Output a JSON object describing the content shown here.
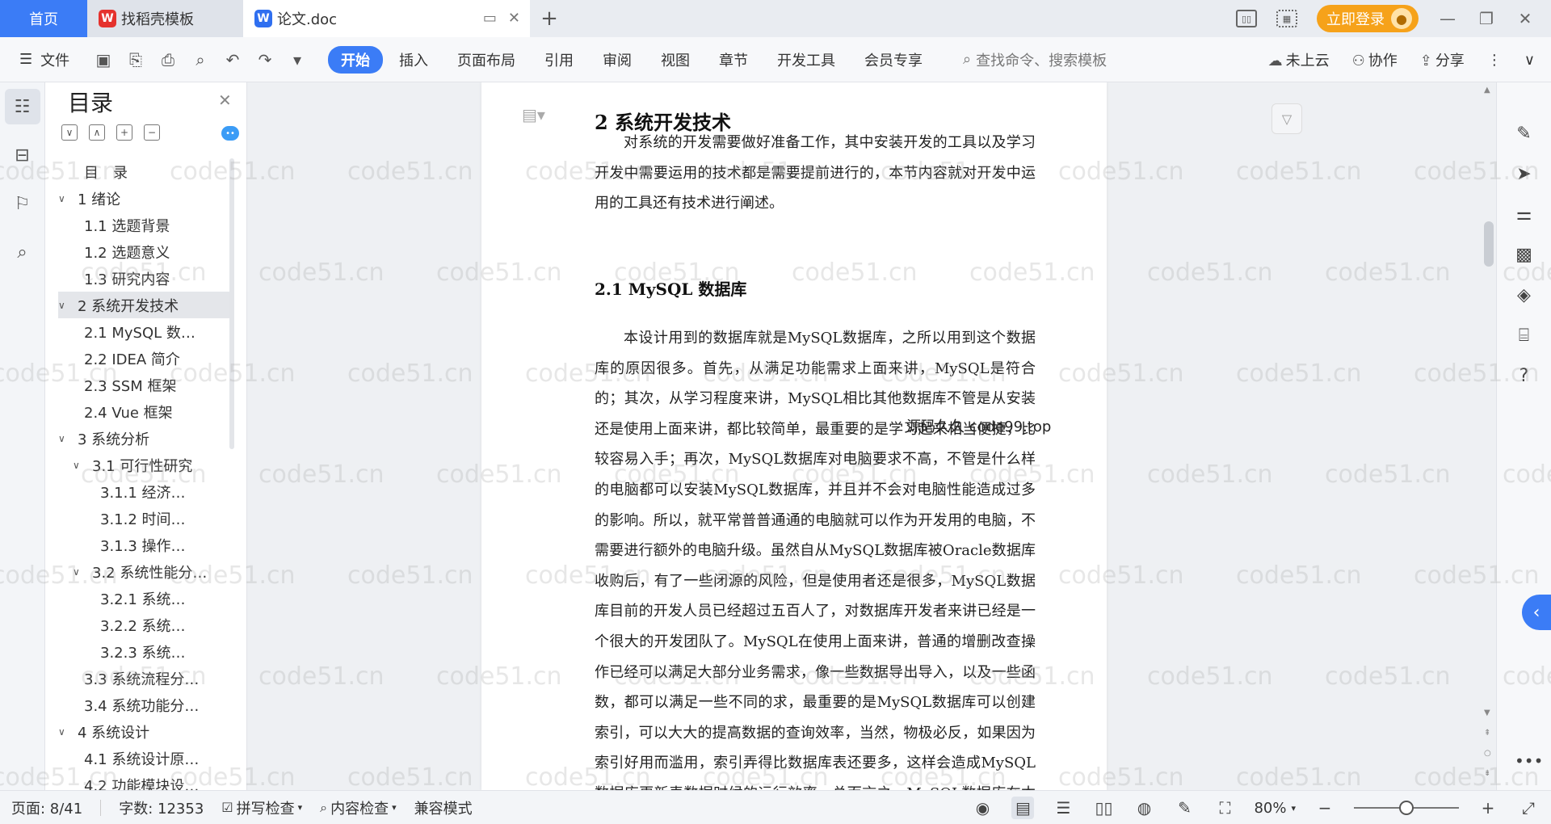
{
  "tabbar": {
    "home_label": "首页",
    "tabs": [
      {
        "label": "找稻壳模板",
        "logo": "W"
      },
      {
        "label": "论文.doc",
        "logo": "W"
      }
    ],
    "add_icon": "+",
    "login_label": "立即登录"
  },
  "ribbon": {
    "file_label": "文件",
    "tabs": [
      "开始",
      "插入",
      "页面布局",
      "引用",
      "审阅",
      "视图",
      "章节",
      "开发工具",
      "会员专享"
    ],
    "active_tab": "开始",
    "search_placeholder": "查找命令、搜索模板",
    "cloud_label": "未上云",
    "collab_label": "协作",
    "share_label": "分享"
  },
  "toc": {
    "title": "目录",
    "items": [
      {
        "label": "目　录",
        "level": 1,
        "chev": ""
      },
      {
        "label": "1  绪论",
        "level": 0,
        "chev": "∨"
      },
      {
        "label": "1.1  选题背景",
        "level": 1,
        "chev": ""
      },
      {
        "label": "1.2  选题意义",
        "level": 1,
        "chev": ""
      },
      {
        "label": "1.3  研究内容",
        "level": 1,
        "chev": ""
      },
      {
        "label": "2  系统开发技术",
        "level": 0,
        "chev": "∨",
        "selected": true
      },
      {
        "label": "2.1 MySQL 数…",
        "level": 1,
        "chev": ""
      },
      {
        "label": "2.2 IDEA 简介",
        "level": 1,
        "chev": ""
      },
      {
        "label": "2.3 SSM 框架",
        "level": 1,
        "chev": ""
      },
      {
        "label": "2.4 Vue 框架",
        "level": 1,
        "chev": ""
      },
      {
        "label": "3  系统分析",
        "level": 0,
        "chev": "∨"
      },
      {
        "label": "3.1  可行性研究",
        "level": 1,
        "chev": "∨"
      },
      {
        "label": "3.1.1  经济…",
        "level": 2,
        "chev": ""
      },
      {
        "label": "3.1.2  时间…",
        "level": 2,
        "chev": ""
      },
      {
        "label": "3.1.3  操作…",
        "level": 2,
        "chev": ""
      },
      {
        "label": "3.2  系统性能分…",
        "level": 1,
        "chev": "∨"
      },
      {
        "label": "3.2.1  系统…",
        "level": 2,
        "chev": ""
      },
      {
        "label": "3.2.2  系统…",
        "level": 2,
        "chev": ""
      },
      {
        "label": "3.2.3  系统…",
        "level": 2,
        "chev": ""
      },
      {
        "label": "3.3  系统流程分…",
        "level": 1,
        "chev": ""
      },
      {
        "label": "3.4  系统功能分…",
        "level": 1,
        "chev": ""
      },
      {
        "label": "4  系统设计",
        "level": 0,
        "chev": "∨"
      },
      {
        "label": "4.1  系统设计原…",
        "level": 1,
        "chev": ""
      },
      {
        "label": "4.2  功能模块设…",
        "level": 1,
        "chev": ""
      }
    ]
  },
  "document": {
    "heading": "2  系统开发技术",
    "para1": "对系统的开发需要做好准备工作，其中安装开发的工具以及学习开发中需要运用的技术都是需要提前进行的，本节内容就对开发中运用的工具还有技术进行阐述。",
    "subheading": "2.1 MySQL 数据库",
    "para2": "本设计用到的数据库就是MySQL数据库，之所以用到这个数据库的原因很多。首先，从满足功能需求上面来讲，MySQL是符合的；其次，从学习程度来讲，MySQL相比其他数据库不管是从安装还是使用上面来讲，都比较简单，最重要的是学习起来相当便捷，比较容易入手；再次，MySQL数据库对电脑要求不高，不管是什么样的电脑都可以安装MySQL数据库，并且并不会对电脑性能造成过多的影响。所以，就平常普普通通的电脑就可以作为开发用的电脑，不需要进行额外的电脑升级。虽然自从MySQL数据库被Oracle数据库收购后，有了一些闭源的风险，但是使用者还是很多，MySQL数据库目前的开发人员已经超过五百人了，对数据库开发者来讲已经是一个很大的开发团队了。MySQL在使用上面来讲，普通的增删改查操作已经可以满足大部分业务需求，像一些数据导出导入，以及一些函数，都可以满足一些不同的求，最重要的是MySQL数据库可以创建索引，可以大大的提高数据的查询效率，当然，物极必反，如果因为索引好用而滥用，索引弄得比数据库表还要多，这样会造成MySQL数据库更新表数据时候的运行效率。总而言之，MySQL数据库在本次设计的使用上，是完全符合使用要求的。",
    "overlay": "源码久久 code99.top",
    "watermark": "code51.cn"
  },
  "statusbar": {
    "page": "页面: 8/41",
    "words": "字数: 12353",
    "spellcheck": "拼写检查",
    "content_check": "内容检查",
    "compat": "兼容模式",
    "zoom": "80%",
    "zoom_fraction": 0.5
  },
  "icons": {
    "home": "home-tab",
    "search": "search-icon",
    "cloud": "cloud-icon",
    "collab": "collab-icon",
    "share": "share-icon"
  }
}
